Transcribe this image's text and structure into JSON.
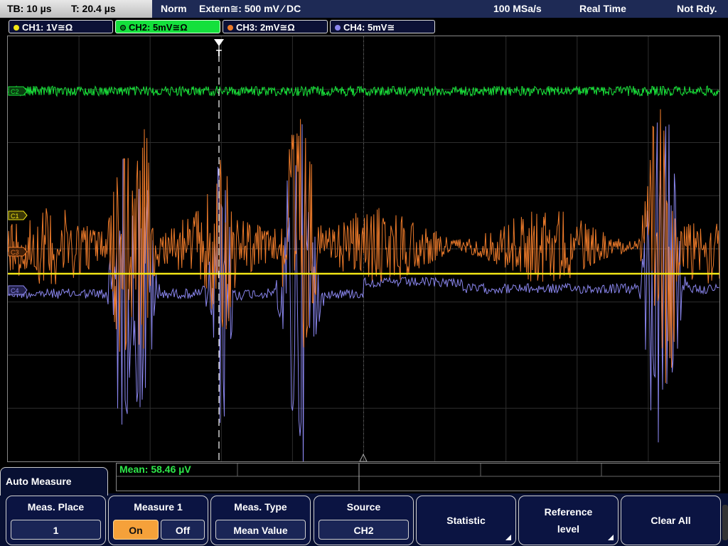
{
  "status": {
    "timebase": "TB: 10 µs",
    "trigger_time": "T: 20.4 µs",
    "trigger_mode": "Norm",
    "trigger_source": "Extern≅: 500 mV ⁄ DC",
    "sample_rate": "100 MSa/s",
    "acq_mode": "Real Time",
    "state": "Not Rdy."
  },
  "channels": [
    {
      "label": "CH1: 1V≅Ω",
      "color": "#f2e616"
    },
    {
      "label": "CH2: 5mV≅Ω",
      "color": "#19e23a"
    },
    {
      "label": "CH3: 2mV≅Ω",
      "color": "#ec7a2a"
    },
    {
      "label": "CH4: 5mV≅",
      "color": "#8a86ee"
    }
  ],
  "markers": {
    "c1": "C1",
    "c2": "C2",
    "c3": "C3",
    "c4": "C4",
    "trigger": "T"
  },
  "measurement": {
    "result": "Mean: 58.46 µV"
  },
  "menu": {
    "title": "Auto Measure",
    "softkeys": [
      {
        "title": "Meas. Place",
        "value": "1"
      },
      {
        "title": "Measure 1",
        "on": "On",
        "off": "Off"
      },
      {
        "title": "Meas. Type",
        "value": "Mean Value"
      },
      {
        "title": "Source",
        "value": "CH2"
      },
      {
        "title": "Statistic"
      },
      {
        "title": "Reference",
        "title2": "level"
      },
      {
        "title": "Clear All"
      }
    ]
  }
}
